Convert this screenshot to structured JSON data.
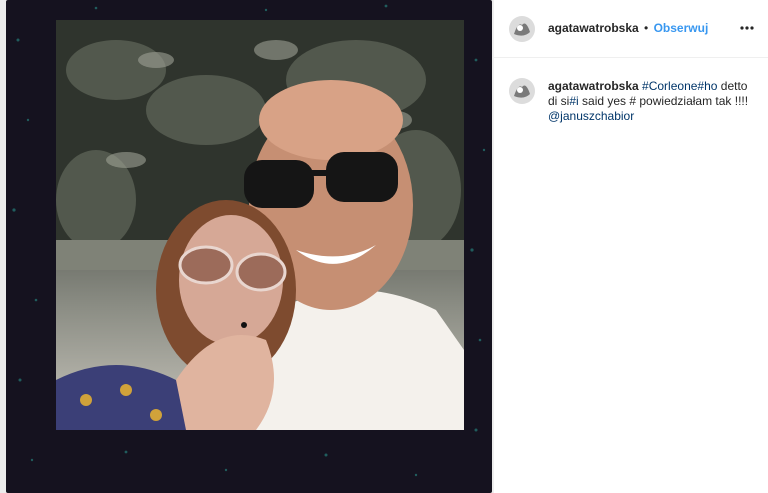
{
  "header": {
    "username": "agatawatrobska",
    "separator": "•",
    "follow_label": "Obserwuj",
    "avatar_icon": "avatar-icon",
    "more_icon": "more-options-icon"
  },
  "caption": {
    "username": "agatawatrobska",
    "tag1": "#Corleone",
    "tag2": "#ho",
    "text1": " detto di si",
    "tag3": "#i",
    "text2": " said yes # powiedziałam tak !!!!",
    "mention": "@januszchabior"
  },
  "colors": {
    "link": "#003569",
    "follow": "#3897f0",
    "text": "#262626",
    "frame": "#15121f"
  }
}
